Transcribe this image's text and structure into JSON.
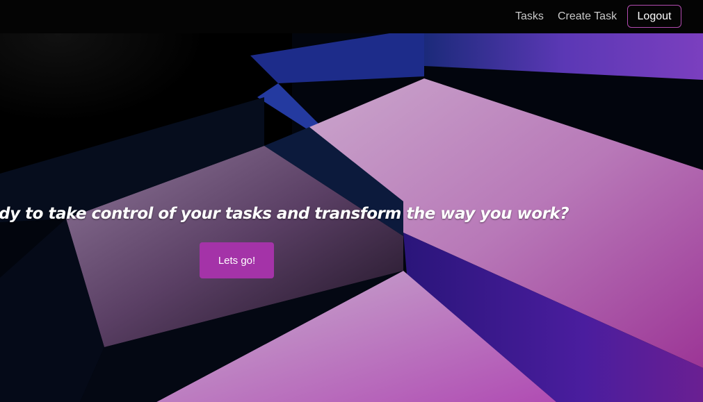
{
  "nav": {
    "links": [
      "Tasks",
      "Create Task"
    ],
    "logout_label": "Logout"
  },
  "hero": {
    "text": "Ready to take control of your tasks and transform the way you work?",
    "cta_label": "Lets go!"
  },
  "colors": {
    "navbar_bg": "#040404",
    "accent": "#a433a8",
    "logout_border": "#b24bb0"
  }
}
